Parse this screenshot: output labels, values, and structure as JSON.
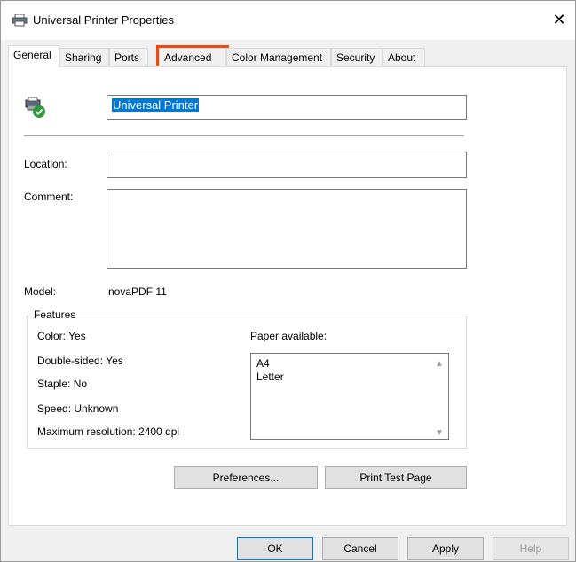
{
  "window": {
    "title": "Universal Printer Properties",
    "close_glyph": "✕"
  },
  "tabs": [
    {
      "label": "General",
      "active": true
    },
    {
      "label": "Sharing"
    },
    {
      "label": "Ports"
    },
    {
      "label": "Advanced",
      "highlighted": true
    },
    {
      "label": "Color Management"
    },
    {
      "label": "Security"
    },
    {
      "label": "About"
    }
  ],
  "general": {
    "printer_name": "Universal Printer",
    "location_label": "Location:",
    "location_value": "",
    "comment_label": "Comment:",
    "comment_value": "",
    "model_label": "Model:",
    "model_value": "novaPDF 11"
  },
  "features": {
    "title": "Features",
    "color": "Color: Yes",
    "double_sided": "Double-sided: Yes",
    "staple": "Staple: No",
    "speed": "Speed: Unknown",
    "max_resolution": "Maximum resolution: 2400 dpi",
    "paper_label": "Paper available:",
    "paper": [
      "A4",
      "Letter"
    ]
  },
  "buttons": {
    "preferences": "Preferences...",
    "print_test_page": "Print Test Page",
    "ok": "OK",
    "cancel": "Cancel",
    "apply": "Apply",
    "help": "Help"
  },
  "colors": {
    "highlight": "#f04a12",
    "selection": "#0078d7",
    "accent_check": "#2e9b3f"
  }
}
